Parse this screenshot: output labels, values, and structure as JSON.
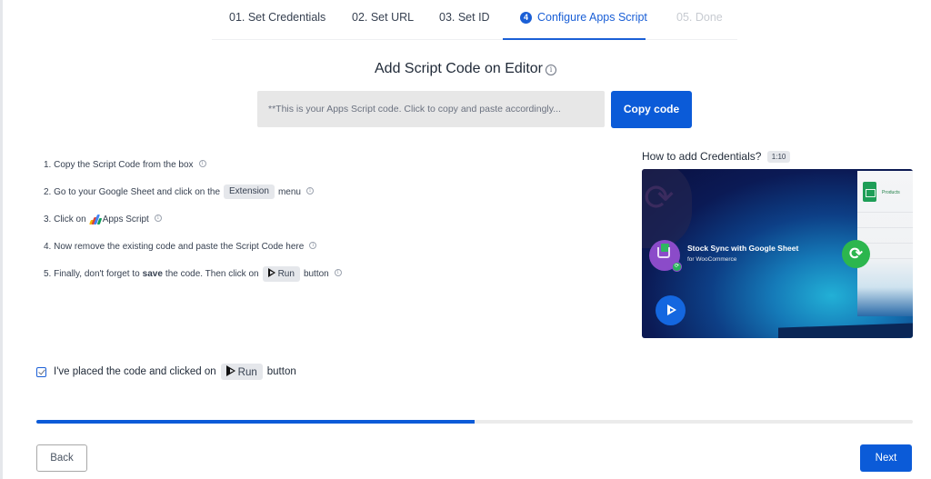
{
  "stepper": {
    "tabs": [
      {
        "label": "01. Set Credentials",
        "state": "completed"
      },
      {
        "label": "02. Set URL",
        "state": "completed"
      },
      {
        "label": "03. Set ID",
        "state": "completed"
      },
      {
        "number": "4",
        "label": "Configure Apps Script",
        "state": "active"
      },
      {
        "label": "05. Done",
        "state": "upcoming"
      }
    ]
  },
  "main": {
    "heading": "Add Script Code on Editor",
    "info_icon": "info-circle-icon",
    "code_box_text": "**This is your Apps Script code. Click to copy and paste accordingly...",
    "copy_button": "Copy code",
    "steps": [
      {
        "parts": [
          "1. Copy the Script Code from the box"
        ]
      },
      {
        "before": "2. Go to your Google Sheet and click on the",
        "chip": "Extension",
        "after": "menu"
      },
      {
        "before": "3. Click on",
        "icon": "apps-script-logo-icon",
        "after": "Apps Script"
      },
      {
        "parts": [
          "4. Now remove the existing code and paste the Script Code here"
        ]
      },
      {
        "before": "5. Finally, don't forget to",
        "bold": "save",
        "middle": "the code. Then click on",
        "chip": "Run",
        "after": "button"
      }
    ]
  },
  "video": {
    "title": "How to add Credentials?",
    "duration": "1:10",
    "plugin_name": "Stock Sync with Google Sheet",
    "plugin_subtitle": "for WooCommerce",
    "sheet_label": "Products"
  },
  "confirm": {
    "checked": true,
    "before": "I've placed the code and clicked on",
    "chip": "Run",
    "after": "button"
  },
  "progress": {
    "value_percent": 50
  },
  "footer": {
    "back_label": "Back",
    "next_label": "Next"
  },
  "colors": {
    "accent": "#0b5bd8",
    "active_tab": "#1a5fd6",
    "muted_tab": "#c7cbd1"
  }
}
